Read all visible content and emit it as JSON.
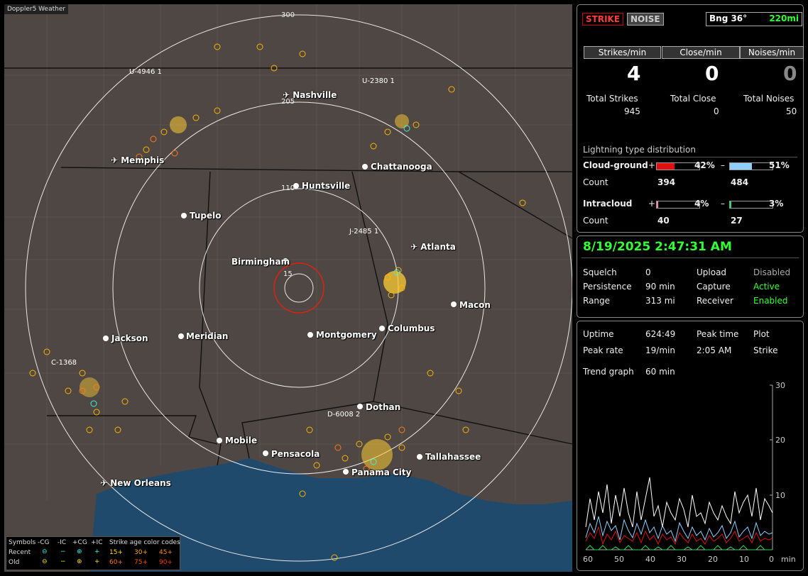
{
  "map": {
    "title": "Doppler5 Weather",
    "ring_labels": [
      "300",
      "205",
      "110",
      "15"
    ],
    "cities": [
      "Nashville",
      "Memphis",
      "Chattanooga",
      "Huntsville",
      "Tupelo",
      "Atlanta",
      "Birmingham",
      "Macon",
      "Columbus",
      "Montgomery",
      "Meridian",
      "Jackson",
      "Dothan",
      "Mobile",
      "Pensacola",
      "Tallahassee",
      "Panama City",
      "New Orleans"
    ],
    "sensors": [
      "U-4946 1",
      "U-2380 1",
      "J-2485 1",
      "C-1368",
      "D-6008 2"
    ],
    "legend": {
      "symbols_label": "Symbols",
      "types": [
        "-CG",
        "-IC",
        "+CG",
        "+IC"
      ],
      "recent": "Recent",
      "old": "Old",
      "age_title": "Strike age color codes",
      "recent_ages": [
        "15+",
        "30+",
        "45+"
      ],
      "old_ages": [
        "60+",
        "75+",
        "90+"
      ]
    }
  },
  "header": {
    "strike": "STRIKE",
    "noise": "NOISE",
    "bearing": "Bng 36°",
    "distance": "220mi"
  },
  "rates": {
    "strikes_label": "Strikes/min",
    "strikes_value": "4",
    "close_label": "Close/min",
    "close_value": "0",
    "noises_label": "Noises/min",
    "noises_value": "0"
  },
  "totals": {
    "strikes_label": "Total Strikes",
    "strikes_value": "945",
    "close_label": "Total Close",
    "close_value": "0",
    "noises_label": "Total Noises",
    "noises_value": "50"
  },
  "distribution": {
    "title": "Lightning type distribution",
    "cg_label": "Cloud-ground",
    "cg_pos_pct": "42%",
    "cg_neg_pct": "51%",
    "cg_pos_count": "394",
    "cg_neg_count": "484",
    "ic_label": "Intracloud",
    "ic_pos_pct": "4%",
    "ic_neg_pct": "3%",
    "ic_pos_count": "40",
    "ic_neg_count": "27",
    "count_label": "Count",
    "plus": "+",
    "minus": "–",
    "cg_pos_fill": 0.42,
    "cg_neg_fill": 0.51,
    "ic_pos_fill": 0.04,
    "ic_neg_fill": 0.03,
    "colors": {
      "cg_pos": "#e01010",
      "cg_neg": "#8ecfff",
      "ic_pos": "#ff7fbf",
      "ic_neg": "#22dd55"
    }
  },
  "status": {
    "datetime": "8/19/2025 2:47:31 AM",
    "squelch_label": "Squelch",
    "squelch_value": "0",
    "persistence_label": "Persistence",
    "persistence_value": "90 min",
    "range_label": "Range",
    "range_value": "313 mi",
    "upload_label": "Upload",
    "upload_value": "Disabled",
    "capture_label": "Capture",
    "capture_value": "Active",
    "receiver_label": "Receiver",
    "receiver_value": "Enabled"
  },
  "trend": {
    "uptime_label": "Uptime",
    "uptime_value": "624:49",
    "peak_time_label": "Peak time",
    "peak_time_value": "2:05 AM",
    "plot_label": "Plot",
    "plot_value": "Strike",
    "peak_rate_label": "Peak rate",
    "peak_rate_value": "19/min",
    "trend_label": "Trend graph",
    "trend_value": "60 min",
    "y_ticks": [
      "30",
      "20",
      "10"
    ],
    "x_ticks": [
      "60",
      "50",
      "40",
      "30",
      "20",
      "10",
      "0"
    ],
    "x_unit": "min"
  }
}
